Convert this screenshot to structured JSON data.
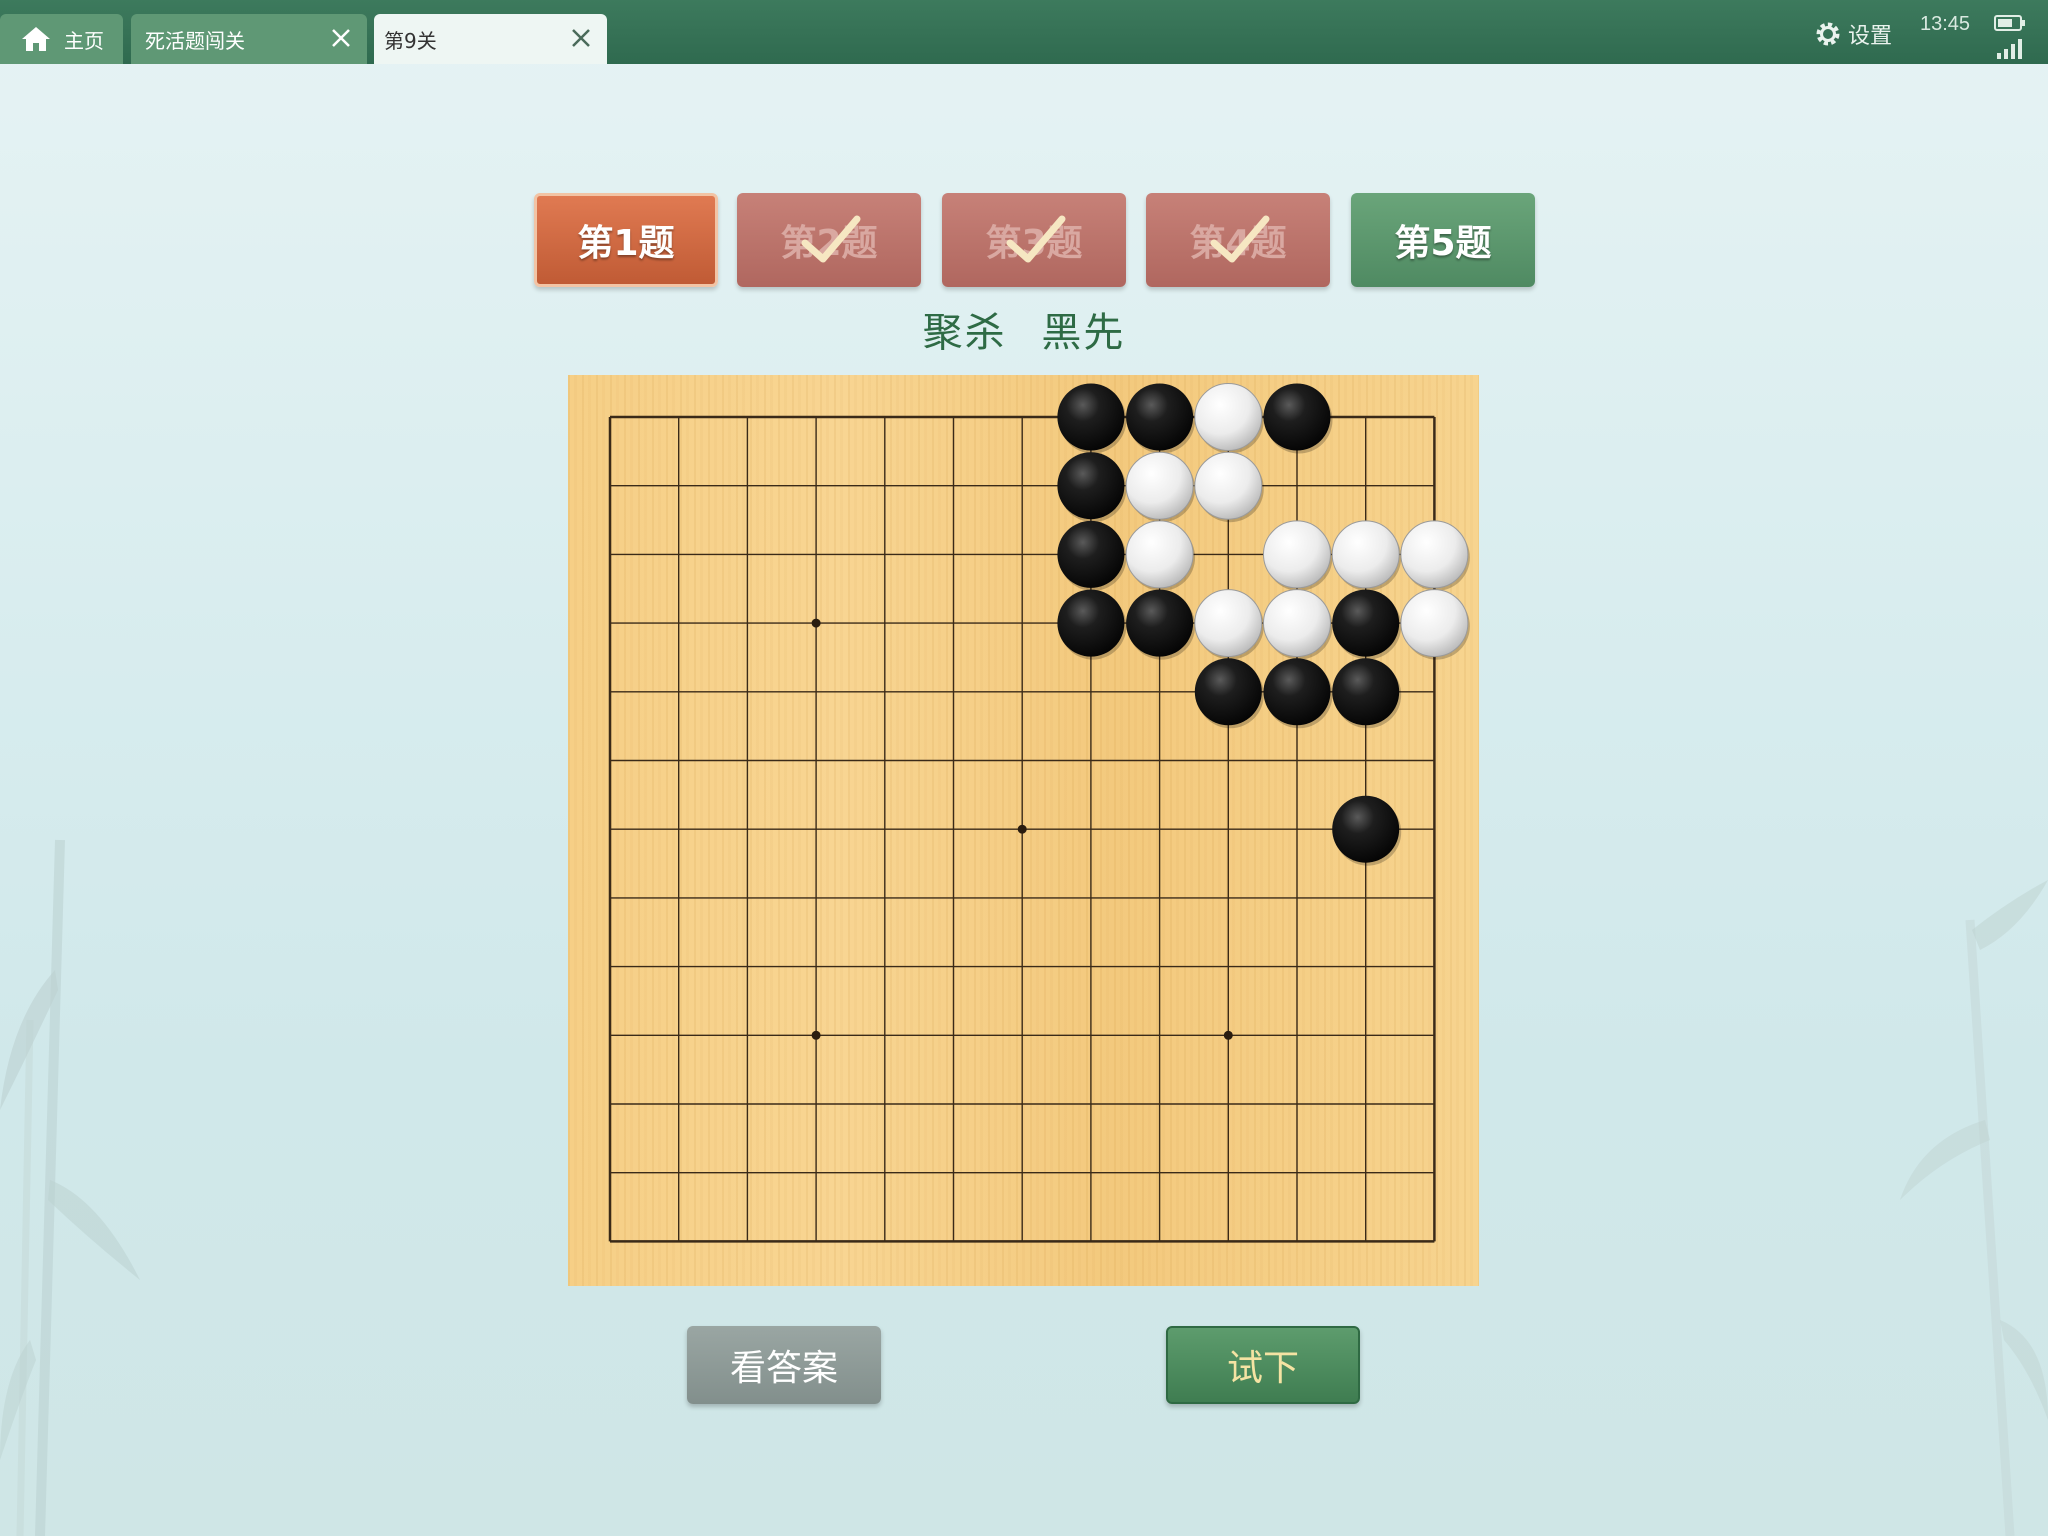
{
  "tabs": [
    {
      "label": "主页",
      "icon": "home-icon",
      "active": false
    },
    {
      "label": "死活题闯关",
      "closable": true,
      "active": false
    },
    {
      "label": "第9关",
      "closable": true,
      "active": true
    }
  ],
  "status": {
    "settings_label": "设置",
    "time": "13:45",
    "battery_icon": "battery-icon",
    "signal_icon": "signal-icon"
  },
  "questions": [
    {
      "label": "第1题",
      "state": "current"
    },
    {
      "label": "第2题",
      "state": "solved"
    },
    {
      "label": "第3题",
      "state": "solved"
    },
    {
      "label": "第4题",
      "state": "solved"
    },
    {
      "label": "第5题",
      "state": "unsolved"
    }
  ],
  "problem": {
    "type": "聚杀",
    "to_play": "黑先"
  },
  "board": {
    "size": 13,
    "star_points": [
      [
        3,
        3
      ],
      [
        6,
        6
      ],
      [
        3,
        9
      ],
      [
        9,
        9
      ]
    ],
    "stones": [
      {
        "color": "black",
        "col": 7,
        "row": 0
      },
      {
        "color": "black",
        "col": 8,
        "row": 0
      },
      {
        "color": "white",
        "col": 9,
        "row": 0
      },
      {
        "color": "black",
        "col": 10,
        "row": 0
      },
      {
        "color": "black",
        "col": 7,
        "row": 1
      },
      {
        "color": "white",
        "col": 8,
        "row": 1
      },
      {
        "color": "white",
        "col": 9,
        "row": 1
      },
      {
        "color": "black",
        "col": 7,
        "row": 2
      },
      {
        "color": "white",
        "col": 8,
        "row": 2
      },
      {
        "color": "white",
        "col": 10,
        "row": 2
      },
      {
        "color": "white",
        "col": 11,
        "row": 2
      },
      {
        "color": "white",
        "col": 12,
        "row": 2
      },
      {
        "color": "black",
        "col": 7,
        "row": 3
      },
      {
        "color": "black",
        "col": 8,
        "row": 3
      },
      {
        "color": "white",
        "col": 9,
        "row": 3
      },
      {
        "color": "white",
        "col": 10,
        "row": 3
      },
      {
        "color": "black",
        "col": 11,
        "row": 3
      },
      {
        "color": "white",
        "col": 12,
        "row": 3
      },
      {
        "color": "black",
        "col": 9,
        "row": 4
      },
      {
        "color": "black",
        "col": 10,
        "row": 4
      },
      {
        "color": "black",
        "col": 11,
        "row": 4
      },
      {
        "color": "black",
        "col": 11,
        "row": 6
      }
    ]
  },
  "actions": {
    "answer_label": "看答案",
    "try_label": "试下"
  },
  "colors": {
    "topbar": "#2f6a4f",
    "current_question": "#c05b35",
    "solved_question": "#b0675f",
    "unsolved_question": "#4f8a62",
    "subtitle": "#2e6b45",
    "board": "#f6cf86"
  }
}
